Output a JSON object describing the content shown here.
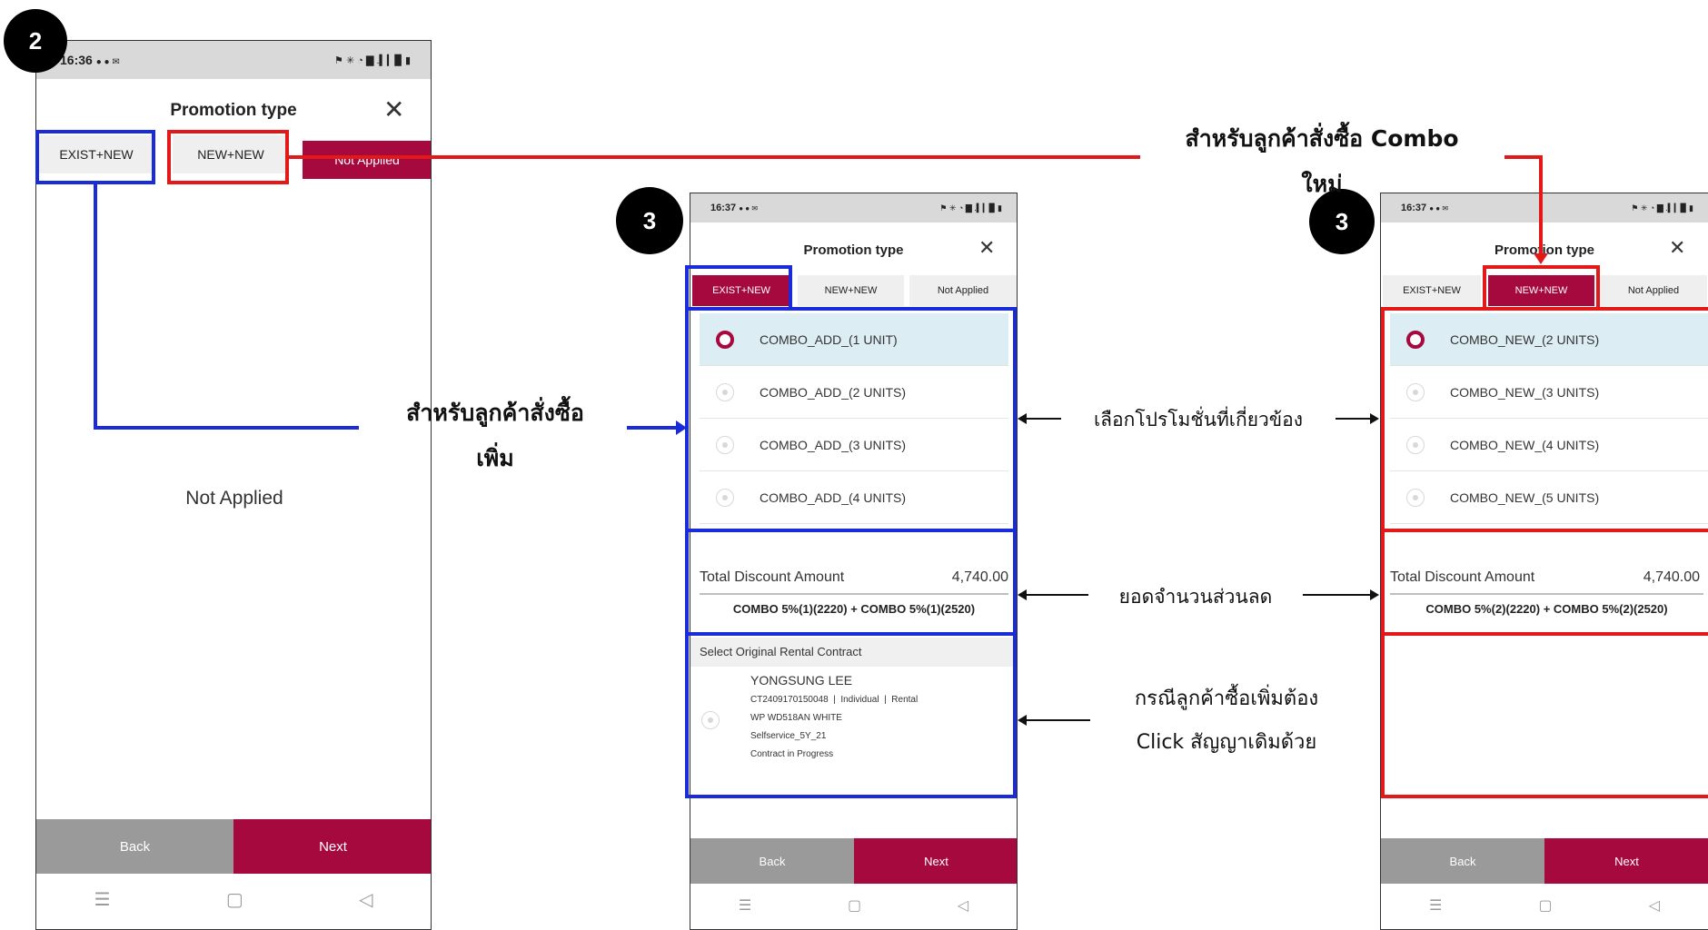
{
  "common": {
    "title": "Promotion type",
    "close_glyph": "✕",
    "tabs": [
      "EXIST+NEW",
      "NEW+NEW",
      "Not Applied"
    ],
    "back_label": "Back",
    "next_label": "Next",
    "nav_icons": [
      "☰",
      "▢",
      "◁"
    ]
  },
  "screen2": {
    "badge": "2",
    "time": "16:36",
    "notif_icons": "● ● ✉",
    "sys_icons": "⚑ ✳ ◔ ▇ .▍▎▉ ▮",
    "empty_text": "Not Applied"
  },
  "screen3a": {
    "badge": "3",
    "time": "16:37",
    "notif_icons": "● ● ✉",
    "sys_icons": "⚑ ✳ ◔ ▇ .▍▎▉ ▮",
    "items": [
      "COMBO_ADD_(1 UNIT)",
      "COMBO_ADD_(2 UNITS)",
      "COMBO_ADD_(3 UNITS)",
      "COMBO_ADD_(4 UNITS)"
    ],
    "total_label": "Total Discount Amount",
    "total_value": "4,740.00",
    "formula": "COMBO 5%(1)(2220) + COMBO 5%(1)(2520)",
    "contract_header": "Select Original Rental Contract",
    "contract": {
      "name": "YONGSUNG LEE",
      "line1": "CT2409170150048  |  Individual  |  Rental",
      "line2": "WP WD518AN WHITE",
      "line3": "Selfservice_5Y_21",
      "line4": "Contract in Progress"
    }
  },
  "screen3b": {
    "badge": "3",
    "time": "16:37",
    "notif_icons": "● ● ✉",
    "sys_icons": "⚑ ✳ ◔ ▇ .▍▎▉ ▮",
    "items": [
      "COMBO_NEW_(2 UNITS)",
      "COMBO_NEW_(3 UNITS)",
      "COMBO_NEW_(4 UNITS)",
      "COMBO_NEW_(5 UNITS)"
    ],
    "total_label": "Total Discount Amount",
    "total_value": "4,740.00",
    "formula": "COMBO 5%(2)(2220) + COMBO 5%(2)(2520)"
  },
  "annotations": {
    "add_order_line1": "สำหรับลูกค้าสั่งซื้อ",
    "add_order_line2": "เพิ่ม",
    "new_combo_line1": "สำหรับลูกค้าสั่งซื้อ Combo",
    "new_combo_line2": "ใหม่",
    "select_promo": "เลือกโปรโมชั่นที่เกี่ยวข้อง",
    "discount_total": "ยอดจำนวนส่วนลด",
    "click_contract_line1": "กรณีลูกค้าซื้อเพิ่มต้อง",
    "click_contract_line2": "Click สัญญาเดิมด้วย"
  },
  "colors": {
    "accent": "#a6093d",
    "highlight_blue": "#1a2bd9",
    "highlight_red": "#e31919",
    "selected_row": "#dcedf4"
  }
}
